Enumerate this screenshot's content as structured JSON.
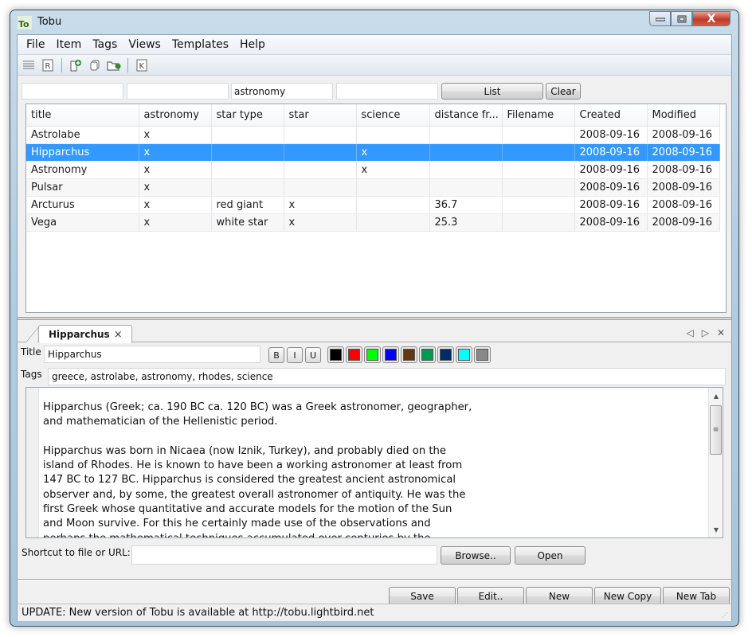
{
  "window": {
    "title": "Tobu",
    "controls": {
      "minimize": "minimize",
      "maximize": "maximize",
      "close": "X"
    }
  },
  "menu": [
    "File",
    "Item",
    "Tags",
    "Views",
    "Templates",
    "Help"
  ],
  "toolbar": {
    "icons": [
      "list-view-icon",
      "document-r-icon",
      "new-item-icon",
      "copy-icon",
      "open-folder-icon",
      "document-k-icon"
    ]
  },
  "filters": {
    "values": [
      "",
      "",
      "astronomy",
      ""
    ],
    "list_label": "List",
    "clear_label": "Clear"
  },
  "table": {
    "columns": [
      "title",
      "astronomy",
      "star type",
      "star",
      "science",
      "distance fr...",
      "Filename",
      "Created",
      "Modified"
    ],
    "rows": [
      [
        "Astrolabe",
        "x",
        "",
        "",
        "",
        "",
        "",
        "2008-09-16",
        "2008-09-16"
      ],
      [
        "Hipparchus",
        "x",
        "",
        "",
        "x",
        "",
        "",
        "2008-09-16",
        "2008-09-16"
      ],
      [
        "Astronomy",
        "x",
        "",
        "",
        "x",
        "",
        "",
        "2008-09-16",
        "2008-09-16"
      ],
      [
        "Pulsar",
        "x",
        "",
        "",
        "",
        "",
        "",
        "2008-09-16",
        "2008-09-16"
      ],
      [
        "Arcturus",
        "x",
        "red giant",
        "x",
        "",
        "36.7",
        "",
        "2008-09-16",
        "2008-09-16"
      ],
      [
        "Vega",
        "x",
        "white star",
        "x",
        "",
        "25.3",
        "",
        "2008-09-16",
        "2008-09-16"
      ]
    ],
    "selected_index": 1,
    "selection_color": "#3399ff"
  },
  "editor": {
    "tab": {
      "label": "Hipparchus",
      "close": "×"
    },
    "tab_nav": {
      "prev": "◁",
      "next": "▷",
      "close": "✕"
    },
    "title_label": "Title",
    "title_value": "Hipparchus",
    "format_buttons": [
      "B",
      "I",
      "U"
    ],
    "colors": [
      "#000000",
      "#ff0000",
      "#00ff00",
      "#0000ff",
      "#603912",
      "#009b4e",
      "#002e63",
      "#00ffff",
      "#888888"
    ],
    "tags_label": "Tags",
    "tags_value": "greece, astrolabe, astronomy, rhodes, science",
    "body": [
      "Hipparchus (Greek; ca. 190 BC ca. 120 BC) was a Greek astronomer, geographer, and mathematician of the Hellenistic period.",
      "Hipparchus was born in Nicaea (now Iznik, Turkey), and probably died on the island of Rhodes. He is known to have been a working astronomer at least from 147 BC to 127 BC. Hipparchus is considered the greatest ancient astronomical observer and, by some, the greatest overall astronomer of antiquity. He was the first Greek whose quantitative and accurate models for the motion of the Sun and Moon survive. For this he certainly made use of the observations and perhaps the mathematical techniques accumulated over centuries by the"
    ],
    "shortcut_label": "Shortcut to file or URL:",
    "shortcut_value": "",
    "browse_label": "Browse..",
    "open_label": "Open"
  },
  "actions": [
    "Save",
    "Edit..",
    "New",
    "New Copy",
    "New Tab"
  ],
  "status": "UPDATE: New version of Tobu is available at http://tobu.lightbird.net"
}
